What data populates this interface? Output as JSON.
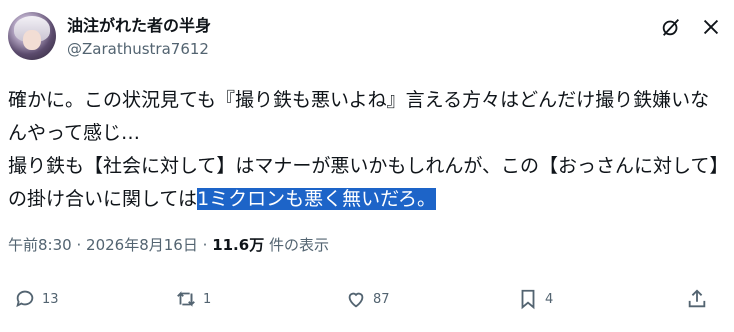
{
  "author": {
    "display_name": "油注がれた者の半身",
    "handle": "@Zarathustra7612",
    "avatar_icon": "avatar-anime-character"
  },
  "post": {
    "text_before_highlight": "確かに。この状況見ても『撮り鉄も悪いよね』言える方々はどんだけ撮り鉄嫌いなんやって感じ…\n撮り鉄も【社会に対して】はマナーが悪いかもしれんが、この【おっさんに対して】の掛け合いに関しては",
    "highlighted_text": "1ミクロンも悪く無いだろ。",
    "highlight_color": "#1d64c8"
  },
  "meta": {
    "time": "午前8:30",
    "separator": "·",
    "date": "2026年8月16日",
    "views_count": "11.6万",
    "views_label": "件の表示"
  },
  "actions": {
    "reply_count": "13",
    "repost_count": "1",
    "like_count": "87",
    "bookmark_count": "4"
  },
  "icons": [
    "grok-icon",
    "more-icon",
    "reply-icon",
    "repost-icon",
    "like-icon",
    "bookmark-icon",
    "share-icon"
  ]
}
